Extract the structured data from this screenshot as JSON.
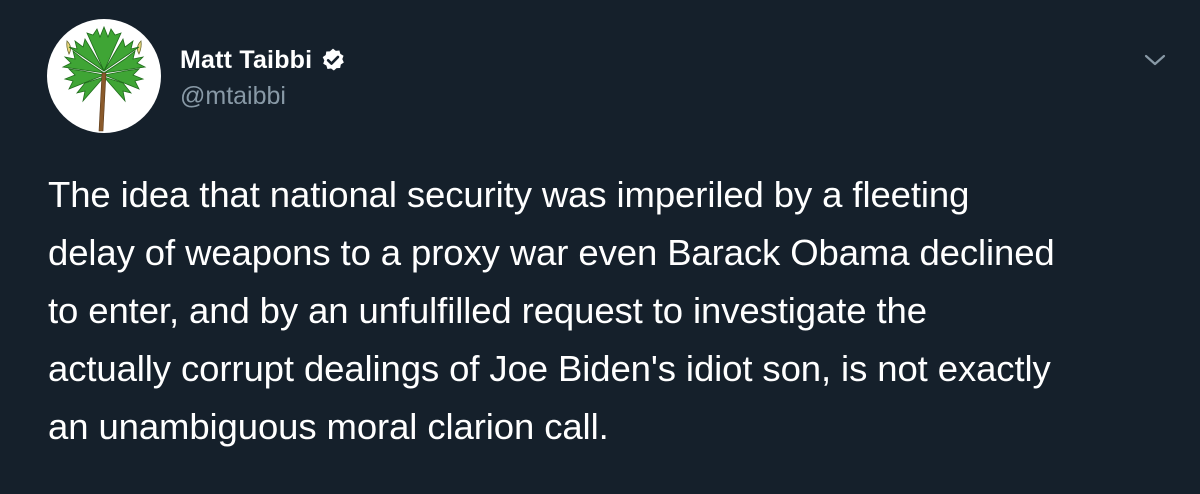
{
  "author": {
    "display_name": "Matt Taibbi",
    "handle": "@mtaibbi",
    "verified": true,
    "avatar_icon": "palmetto-tree-icon"
  },
  "menu": {
    "icon": "chevron-down-icon"
  },
  "tweet": {
    "lines": [
      "The idea that national security was imperiled by a fleeting",
      "delay of weapons to a proxy war even Barack Obama declined",
      "to enter, and by an unfulfilled request to investigate the",
      "actually corrupt dealings of Joe Biden's idiot son, is not exactly",
      "an unambiguous moral clarion call."
    ]
  },
  "colors": {
    "background": "#15202b",
    "text": "#ffffff",
    "secondary_text": "#8899a6",
    "palm_green": "#3fa535",
    "trunk_brown": "#8a5a2b",
    "crescent_yellow": "#e8d77a"
  }
}
